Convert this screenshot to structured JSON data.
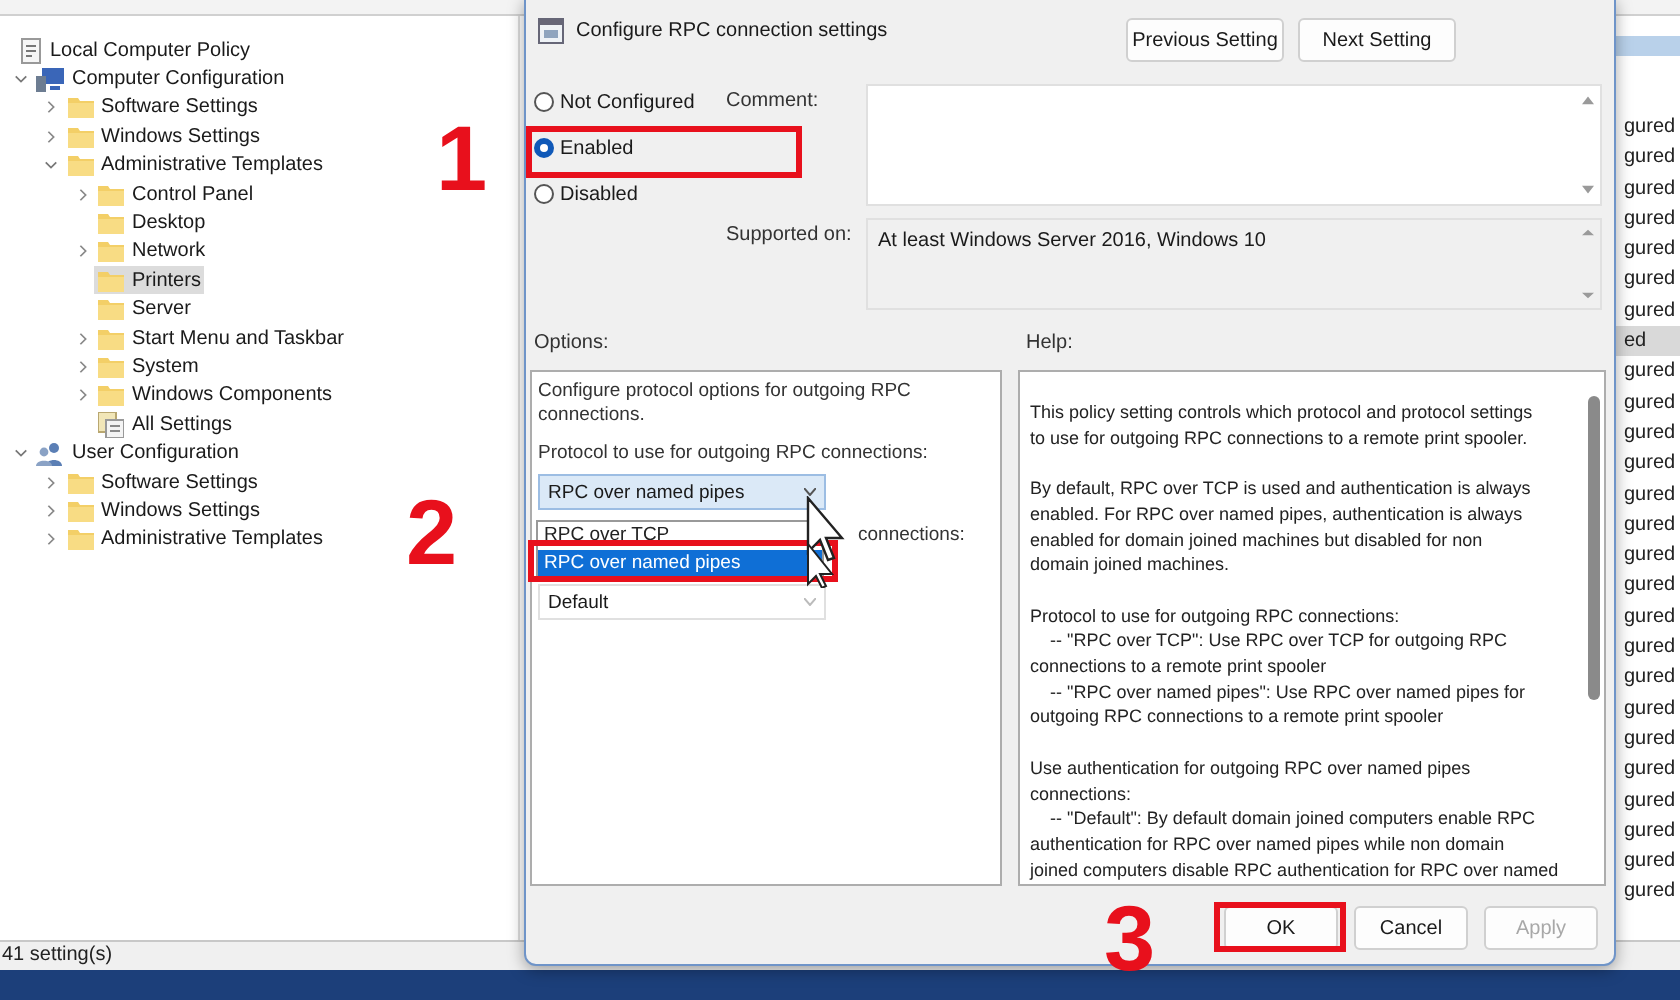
{
  "tree": {
    "items": [
      {
        "label": "Local Computer Policy",
        "kind": "policy",
        "selected": false,
        "children": [
          {
            "label": "Computer Configuration",
            "kind": "computer",
            "selected": false,
            "expanded": true,
            "children": [
              {
                "label": "Software Settings",
                "kind": "folder",
                "selected": false,
                "expanded": false
              },
              {
                "label": "Windows Settings",
                "kind": "folder",
                "selected": false,
                "expanded": false
              },
              {
                "label": "Administrative Templates",
                "kind": "folder",
                "selected": false,
                "expanded": true,
                "children": [
                  {
                    "label": "Control Panel",
                    "kind": "folder",
                    "selected": false,
                    "expanded": false
                  },
                  {
                    "label": "Desktop",
                    "kind": "folder",
                    "selected": false
                  },
                  {
                    "label": "Network",
                    "kind": "folder",
                    "selected": false,
                    "expanded": false
                  },
                  {
                    "label": "Printers",
                    "kind": "folder",
                    "selected": true
                  },
                  {
                    "label": "Server",
                    "kind": "folder",
                    "selected": false
                  },
                  {
                    "label": "Start Menu and Taskbar",
                    "kind": "folder",
                    "selected": false,
                    "expanded": false
                  },
                  {
                    "label": "System",
                    "kind": "folder",
                    "selected": false,
                    "expanded": false
                  },
                  {
                    "label": "Windows Components",
                    "kind": "folder",
                    "selected": false,
                    "expanded": false
                  },
                  {
                    "label": "All Settings",
                    "kind": "settings",
                    "selected": false
                  }
                ]
              }
            ]
          },
          {
            "label": "User Configuration",
            "kind": "user",
            "selected": false,
            "expanded": true,
            "children": [
              {
                "label": "Software Settings",
                "kind": "folder",
                "selected": false,
                "expanded": false
              },
              {
                "label": "Windows Settings",
                "kind": "folder",
                "selected": false,
                "expanded": false
              },
              {
                "label": "Administrative Templates",
                "kind": "folder",
                "selected": false,
                "expanded": false
              }
            ]
          }
        ]
      }
    ]
  },
  "settings_list": {
    "rows": [
      {
        "text": "gured",
        "selected": false
      },
      {
        "text": "gured",
        "selected": false
      },
      {
        "text": "gured",
        "selected": false
      },
      {
        "text": "gured",
        "selected": false
      },
      {
        "text": "gured",
        "selected": false
      },
      {
        "text": "gured",
        "selected": false
      },
      {
        "text": "gured",
        "selected": false
      },
      {
        "text": "ed",
        "selected": true
      },
      {
        "text": "gured",
        "selected": false
      },
      {
        "text": "gured",
        "selected": false
      },
      {
        "text": "gured",
        "selected": false
      },
      {
        "text": "gured",
        "selected": false
      },
      {
        "text": "gured",
        "selected": false
      },
      {
        "text": "gured",
        "selected": false
      },
      {
        "text": "gured",
        "selected": false
      },
      {
        "text": "gured",
        "selected": false
      },
      {
        "text": "gured",
        "selected": false
      },
      {
        "text": "gured",
        "selected": false
      },
      {
        "text": "gured",
        "selected": false
      },
      {
        "text": "gured",
        "selected": false
      },
      {
        "text": "gured",
        "selected": false
      },
      {
        "text": "gured",
        "selected": false
      },
      {
        "text": "gured",
        "selected": false
      },
      {
        "text": "gured",
        "selected": false
      },
      {
        "text": "gured",
        "selected": false
      },
      {
        "text": "gured",
        "selected": false
      }
    ]
  },
  "status_bar": "41 setting(s)",
  "dialog": {
    "title": "Configure RPC connection settings",
    "nav_buttons": [
      "Previous Setting",
      "Next Setting"
    ],
    "radios": [
      {
        "label": "Not Configured",
        "selected": false
      },
      {
        "label": "Enabled",
        "selected": true
      },
      {
        "label": "Disabled",
        "selected": false
      }
    ],
    "comment_label": "Comment:",
    "supported_label": "Supported on:",
    "supported_value": "At least Windows Server 2016, Windows 10",
    "options_label": "Options:",
    "help_label": "Help:",
    "options": {
      "description": "Configure protocol options for outgoing RPC connections.",
      "protocol_label": "Protocol to use for outgoing RPC connections:",
      "protocol_select": {
        "value": "RPC over named pipes",
        "expanded": true,
        "options": [
          {
            "label": "RPC over TCP",
            "selected": false
          },
          {
            "label": "RPC over named pipes",
            "selected": true
          }
        ]
      },
      "auth_label": "connections:",
      "auth_select": {
        "value": "Default"
      }
    },
    "help": [
      [
        "This policy setting controls which protocol and protocol settings",
        "to use for outgoing RPC connections to a remote print spooler."
      ],
      [
        "By default, RPC over TCP is used and authentication is always",
        "enabled. For RPC over named pipes, authentication is always",
        "enabled for domain joined machines but disabled for non",
        "domain joined machines."
      ],
      [
        "Protocol to use for outgoing RPC connections:",
        "    -- \"RPC over TCP\": Use RPC over TCP for outgoing RPC",
        "connections to a remote print spooler",
        "    -- \"RPC over named pipes\": Use RPC over named pipes for",
        "outgoing RPC connections to a remote print spooler"
      ],
      [
        "Use authentication for outgoing RPC over named pipes",
        "connections:",
        "    -- \"Default\": By default domain joined computers enable RPC",
        "authentication for RPC over named pipes while non domain",
        "joined computers disable RPC authentication for RPC over named"
      ]
    ],
    "buttons": [
      {
        "label": "OK",
        "disabled": false
      },
      {
        "label": "Cancel",
        "disabled": false
      },
      {
        "label": "Apply",
        "disabled": true
      }
    ]
  },
  "annotations": [
    "1",
    "2",
    "3"
  ]
}
